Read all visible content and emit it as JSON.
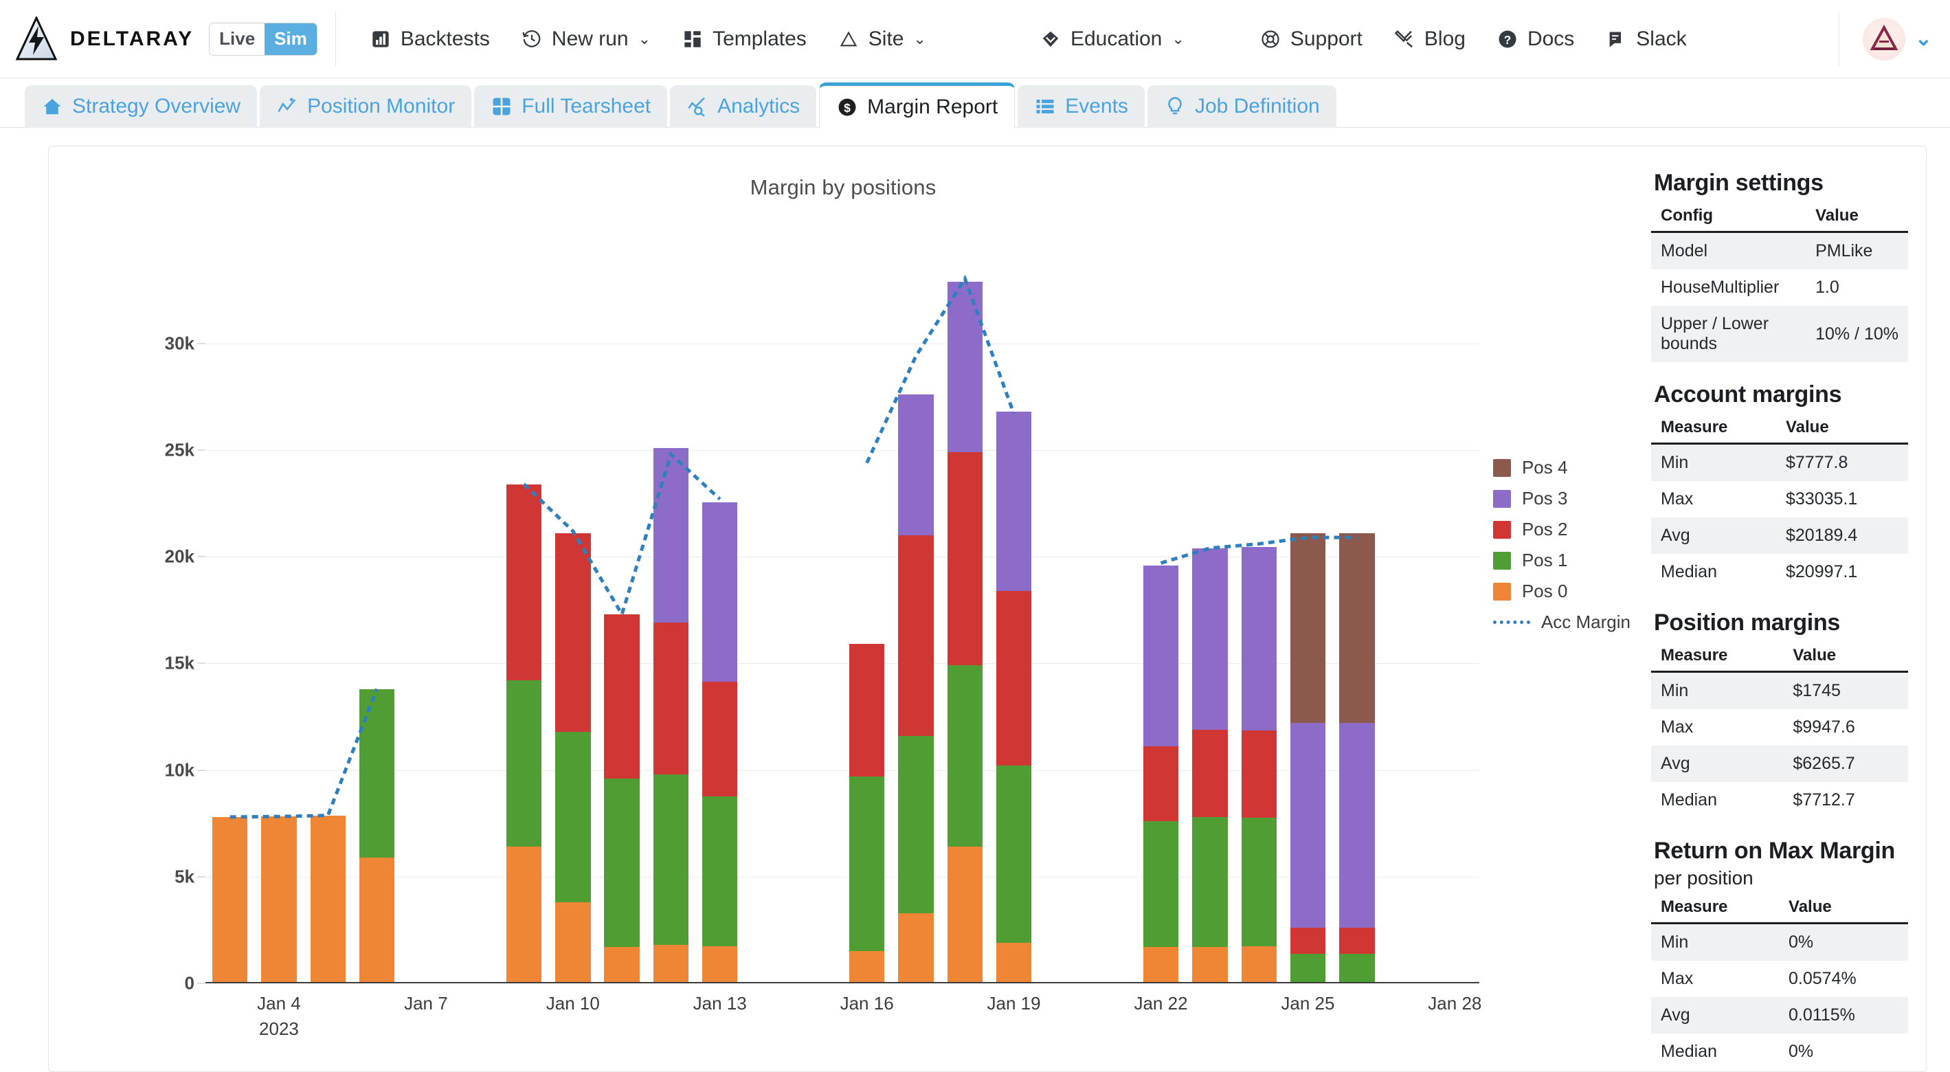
{
  "brand": {
    "name": "DELTARAY",
    "mode_live": "Live",
    "mode_sim": "Sim",
    "logo_icon": "deltaray-lightning-logo",
    "accent": "#5aaee0"
  },
  "topnav": {
    "left_items": [
      {
        "label": "Backtests",
        "icon": "bar-chart-icon",
        "caret": ""
      },
      {
        "label": "New run",
        "icon": "history-clock-icon",
        "caret": "⌄"
      },
      {
        "label": "Templates",
        "icon": "layout-grid-icon",
        "caret": ""
      },
      {
        "label": "Site",
        "icon": "triangle-icon",
        "caret": "⌄"
      }
    ],
    "mid_items": [
      {
        "label": "Education",
        "icon": "diamond-icon",
        "caret": "⌄"
      }
    ],
    "right_items": [
      {
        "label": "Support",
        "icon": "lifebuoy-icon",
        "caret": ""
      },
      {
        "label": "Blog",
        "icon": "tools-icon",
        "caret": ""
      },
      {
        "label": "Docs",
        "icon": "question-circle-icon",
        "caret": ""
      },
      {
        "label": "Slack",
        "icon": "chat-icon",
        "caret": ""
      }
    ],
    "avatar_icon": "user-avatar",
    "avatar_caret": "⌄"
  },
  "tabs": [
    {
      "label": "Strategy Overview",
      "icon": "home-icon",
      "active": false
    },
    {
      "label": "Position Monitor",
      "icon": "trend-sparkle-icon",
      "active": false
    },
    {
      "label": "Full Tearsheet",
      "icon": "grid-table-icon",
      "active": false
    },
    {
      "label": "Analytics",
      "icon": "chart-magnifier-icon",
      "active": false
    },
    {
      "label": "Margin Report",
      "icon": "dollar-coin-icon",
      "active": true
    },
    {
      "label": "Events",
      "icon": "list-icon",
      "active": false
    },
    {
      "label": "Job Definition",
      "icon": "lightbulb-icon",
      "active": false
    }
  ],
  "chart_data": {
    "type": "bar",
    "stacked": true,
    "title": "Margin by positions",
    "xlabel": "",
    "ylabel": "",
    "ylim": [
      0,
      33500
    ],
    "yticks": [
      0,
      5000,
      10000,
      15000,
      20000,
      25000,
      30000
    ],
    "ytick_labels": [
      "0",
      "5k",
      "10k",
      "15k",
      "20k",
      "25k",
      "30k"
    ],
    "grid": true,
    "legend_position": "right",
    "x_axis_year": "2023",
    "categories": [
      "Jan 3",
      "Jan 4",
      "Jan 5",
      "Jan 6",
      "Jan 7",
      "Jan 8",
      "Jan 9",
      "Jan 10",
      "Jan 11",
      "Jan 12",
      "Jan 13",
      "Jan 14",
      "Jan 15",
      "Jan 16",
      "Jan 17",
      "Jan 18",
      "Jan 19",
      "Jan 20",
      "Jan 21",
      "Jan 22",
      "Jan 23",
      "Jan 24",
      "Jan 25",
      "Jan 26",
      "Jan 27",
      "Jan 28"
    ],
    "xtick_labels": [
      "Jan 4",
      "Jan 7",
      "Jan 10",
      "Jan 13",
      "Jan 16",
      "Jan 19",
      "Jan 22",
      "Jan 25",
      "Jan 28"
    ],
    "xtick_indices": [
      1,
      4,
      7,
      10,
      13,
      16,
      19,
      22,
      25
    ],
    "series": [
      {
        "name": "Pos 0",
        "color": "#ee8636",
        "values": [
          7800,
          7820,
          7850,
          5900,
          0,
          0,
          6400,
          3800,
          1700,
          1800,
          1750,
          0,
          0,
          1500,
          3300,
          6400,
          1900,
          0,
          0,
          1700,
          1700,
          1750,
          0,
          0,
          0,
          0
        ]
      },
      {
        "name": "Pos 1",
        "color": "#4f9d33",
        "values": [
          0,
          0,
          0,
          7900,
          0,
          0,
          7800,
          8000,
          7900,
          8000,
          7000,
          0,
          0,
          8200,
          8300,
          8500,
          8300,
          0,
          0,
          5900,
          6100,
          6000,
          1400,
          1400,
          0,
          0
        ]
      },
      {
        "name": "Pos 2",
        "color": "#cf3634",
        "values": [
          0,
          0,
          0,
          0,
          0,
          0,
          9200,
          9300,
          7700,
          7100,
          5400,
          0,
          0,
          6200,
          9400,
          10000,
          8200,
          0,
          0,
          3500,
          4100,
          4100,
          1200,
          1200,
          0,
          0
        ]
      },
      {
        "name": "Pos 3",
        "color": "#8d6cc9",
        "values": [
          0,
          0,
          0,
          0,
          0,
          0,
          0,
          0,
          0,
          8200,
          8400,
          0,
          0,
          0,
          6600,
          8000,
          8400,
          0,
          0,
          8500,
          8500,
          8600,
          9600,
          9600,
          0,
          0
        ]
      },
      {
        "name": "Pos 4",
        "color": "#8c5a4d",
        "values": [
          0,
          0,
          0,
          0,
          0,
          0,
          0,
          0,
          0,
          0,
          0,
          0,
          0,
          0,
          0,
          0,
          0,
          0,
          0,
          0,
          0,
          0,
          8900,
          8900,
          0,
          0
        ]
      }
    ],
    "overlay": {
      "name": "Acc Margin",
      "color": "#2f7fbf",
      "style": "dotted",
      "values": [
        7800,
        7820,
        7870,
        13800,
        0,
        0,
        23400,
        21200,
        17300,
        24800,
        22700,
        0,
        0,
        24400,
        29400,
        33035,
        26700,
        0,
        0,
        19700,
        20400,
        20600,
        20900,
        20900,
        0,
        0
      ]
    },
    "legend_entries": [
      "Pos 4",
      "Pos 3",
      "Pos 2",
      "Pos 1",
      "Pos 0",
      "Acc Margin"
    ]
  },
  "sidebar": {
    "margin_settings": {
      "title": "Margin settings",
      "headers": [
        "Config",
        "Value"
      ],
      "rows": [
        [
          "Model",
          "PMLike"
        ],
        [
          "HouseMultiplier",
          "1.0"
        ],
        [
          "Upper / Lower bounds",
          "10% / 10%"
        ]
      ]
    },
    "account_margins": {
      "title": "Account margins",
      "headers": [
        "Measure",
        "Value"
      ],
      "rows": [
        [
          "Min",
          "$7777.8"
        ],
        [
          "Max",
          "$33035.1"
        ],
        [
          "Avg",
          "$20189.4"
        ],
        [
          "Median",
          "$20997.1"
        ]
      ]
    },
    "position_margins": {
      "title": "Position margins",
      "headers": [
        "Measure",
        "Value"
      ],
      "rows": [
        [
          "Min",
          "$1745"
        ],
        [
          "Max",
          "$9947.6"
        ],
        [
          "Avg",
          "$6265.7"
        ],
        [
          "Median",
          "$7712.7"
        ]
      ]
    },
    "return_on_max_margin": {
      "title": "Return on Max Margin",
      "subtitle": "per position",
      "headers": [
        "Measure",
        "Value"
      ],
      "rows": [
        [
          "Min",
          "0%"
        ],
        [
          "Max",
          "0.0574%"
        ],
        [
          "Avg",
          "0.0115%"
        ],
        [
          "Median",
          "0%"
        ]
      ]
    }
  }
}
